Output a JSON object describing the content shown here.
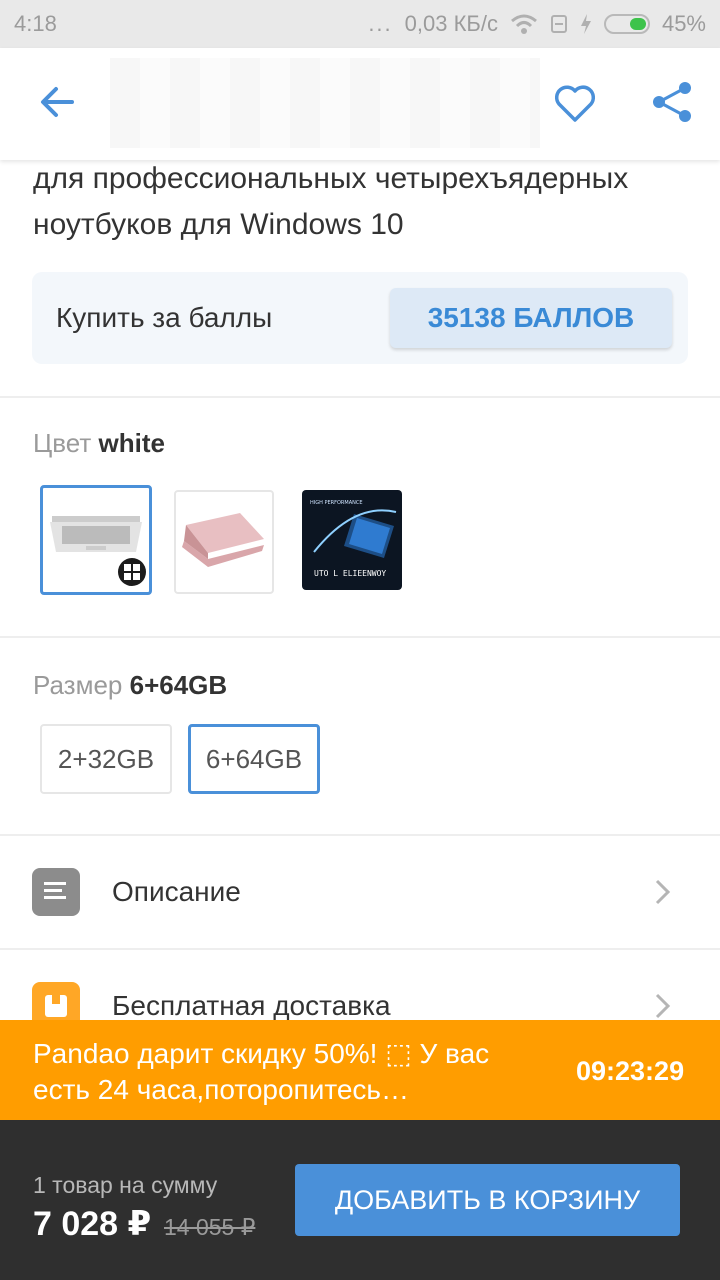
{
  "status_bar": {
    "time": "4:18",
    "dots": "...",
    "speed": "0,03 КБ/с",
    "battery_percent": "45%"
  },
  "product": {
    "title": "для профессиональных четырехъядерных ноутбуков для Windows 10"
  },
  "points": {
    "label": "Купить за баллы",
    "button": "35138 БАЛЛОВ"
  },
  "color": {
    "label": "Цвет",
    "value": "white"
  },
  "thumb_text": {
    "brand_line": "UTO   L  ELIEENWOY",
    "tagline": "HIGH PERFORMANCE"
  },
  "size": {
    "label": "Размер",
    "value": "6+64GB",
    "options": [
      "2+32GB",
      "6+64GB"
    ]
  },
  "rows": {
    "description": "Описание",
    "shipping": "Бесплатная доставка"
  },
  "promo": {
    "text": "Pandao дарит скидку 50%! ⬚ У вас есть 24 часа,поторопитесь…",
    "timer": "09:23:29"
  },
  "bottom": {
    "sum_label": "1 товар на сумму",
    "price": "7 028 ₽",
    "old_price": "14 055 ₽",
    "cart_button": "ДОБАВИТЬ В КОРЗИНУ"
  },
  "colors": {
    "accent": "#4a90d9",
    "promo": "#ff9d00",
    "bottom_bar": "#2f2f2f"
  }
}
